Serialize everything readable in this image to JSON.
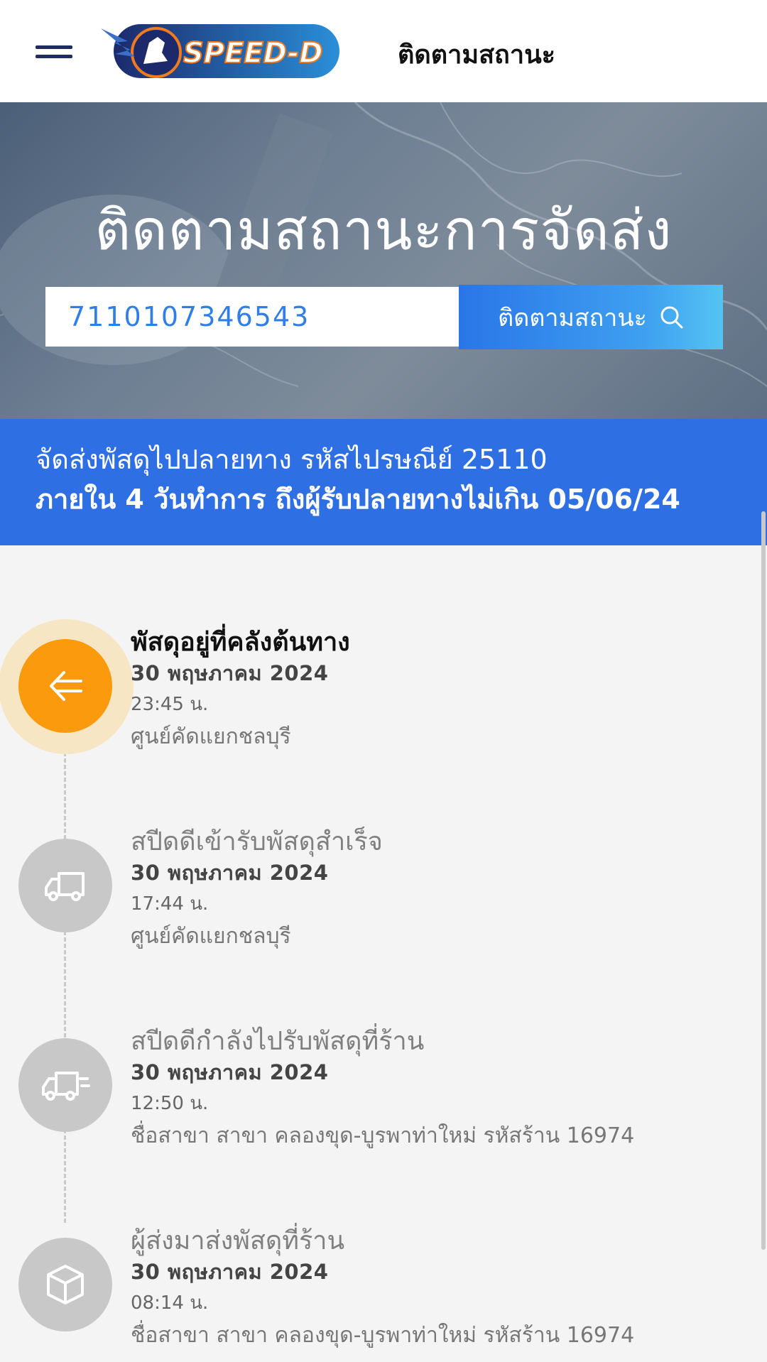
{
  "header": {
    "brand": "SPEED-D",
    "title": "ติดตามสถานะ"
  },
  "hero": {
    "title": "ติดตามสถานะการจัดส่ง",
    "tracking_value": "7110107346543",
    "button_label": "ติดตามสถานะ"
  },
  "banner": {
    "line1": "จัดส่งพัสดุไปปลายทาง รหัสไปรษณีย์ 25110",
    "line2": "ภายใน 4 วันทำการ ถึงผู้รับปลายทางไม่เกิน 05/06/24"
  },
  "timeline": [
    {
      "icon": "arrow-left-icon",
      "title": "พัสดุอยู่ที่คลังต้นทาง",
      "date": "30 พฤษภาคม 2024",
      "time": "23:45 น.",
      "location": "ศูนย์คัดแยกชลบุรี",
      "active": true
    },
    {
      "icon": "truck-icon",
      "title": "สปีดดีเข้ารับพัสดุสำเร็จ",
      "date": "30 พฤษภาคม 2024",
      "time": "17:44 น.",
      "location": "ศูนย์คัดแยกชลบุรี",
      "active": false
    },
    {
      "icon": "fast-truck-icon",
      "title": "สปีดดีกำลังไปรับพัสดุที่ร้าน",
      "date": "30 พฤษภาคม 2024",
      "time": "12:50 น.",
      "location": "ชื่อสาขา สาขา คลองขุด-บูรพาท่าใหม่ รหัสร้าน 16974",
      "active": false
    },
    {
      "icon": "box-icon",
      "title": "ผู้ส่งมาส่งพัสดุที่ร้าน",
      "date": "30 พฤษภาคม 2024",
      "time": "08:14 น.",
      "location": "ชื่อสาขา สาขา คลองขุด-บูรพาท่าใหม่ รหัสร้าน 16974",
      "active": false
    }
  ],
  "colors": {
    "accent": "#2f6fe4",
    "active_status": "#fb9a0c",
    "inactive_status": "#c8c8c8"
  }
}
